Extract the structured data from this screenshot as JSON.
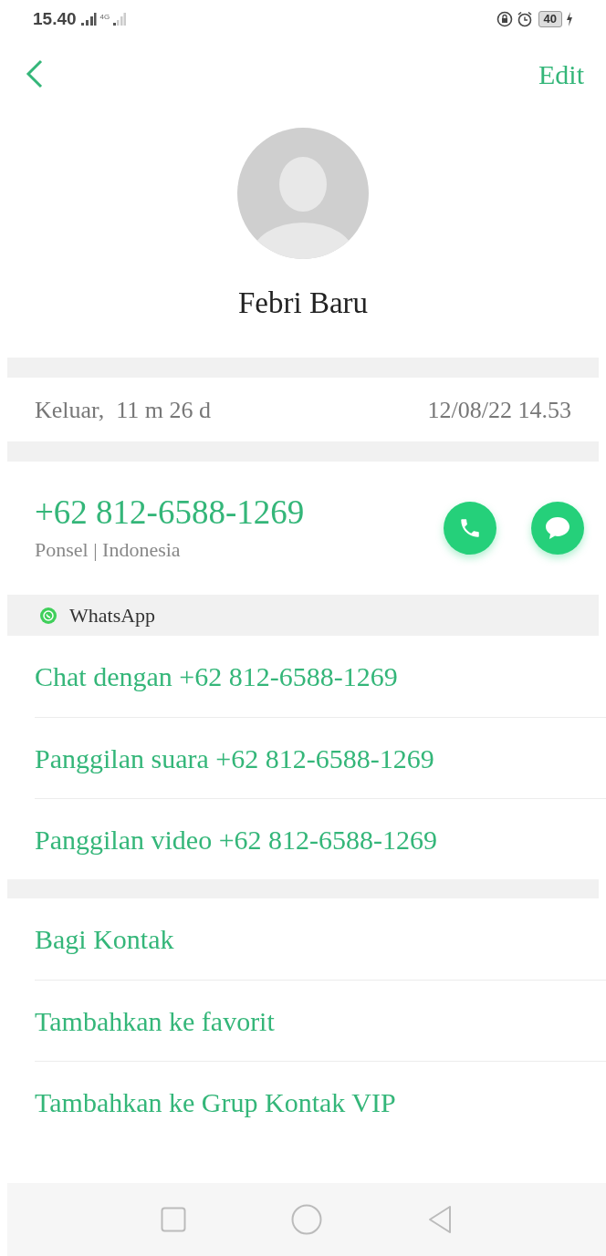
{
  "status_bar": {
    "time": "15.40",
    "network": "4G",
    "battery": "40"
  },
  "header": {
    "edit": "Edit"
  },
  "contact": {
    "name": "Febri Baru"
  },
  "last_call": {
    "status": "Keluar,  11 m 26 d",
    "time": "12/08/22 14.53"
  },
  "phone": {
    "number": "+62 812-6588-1269",
    "type": "Ponsel | Indonesia"
  },
  "whatsapp": {
    "label": "WhatsApp",
    "actions": [
      "Chat dengan +62 812-6588-1269",
      "Panggilan suara +62 812-6588-1269",
      "Panggilan video +62 812-6588-1269"
    ]
  },
  "options": [
    "Bagi Kontak",
    "Tambahkan ke favorit",
    "Tambahkan ke Grup Kontak VIP"
  ]
}
